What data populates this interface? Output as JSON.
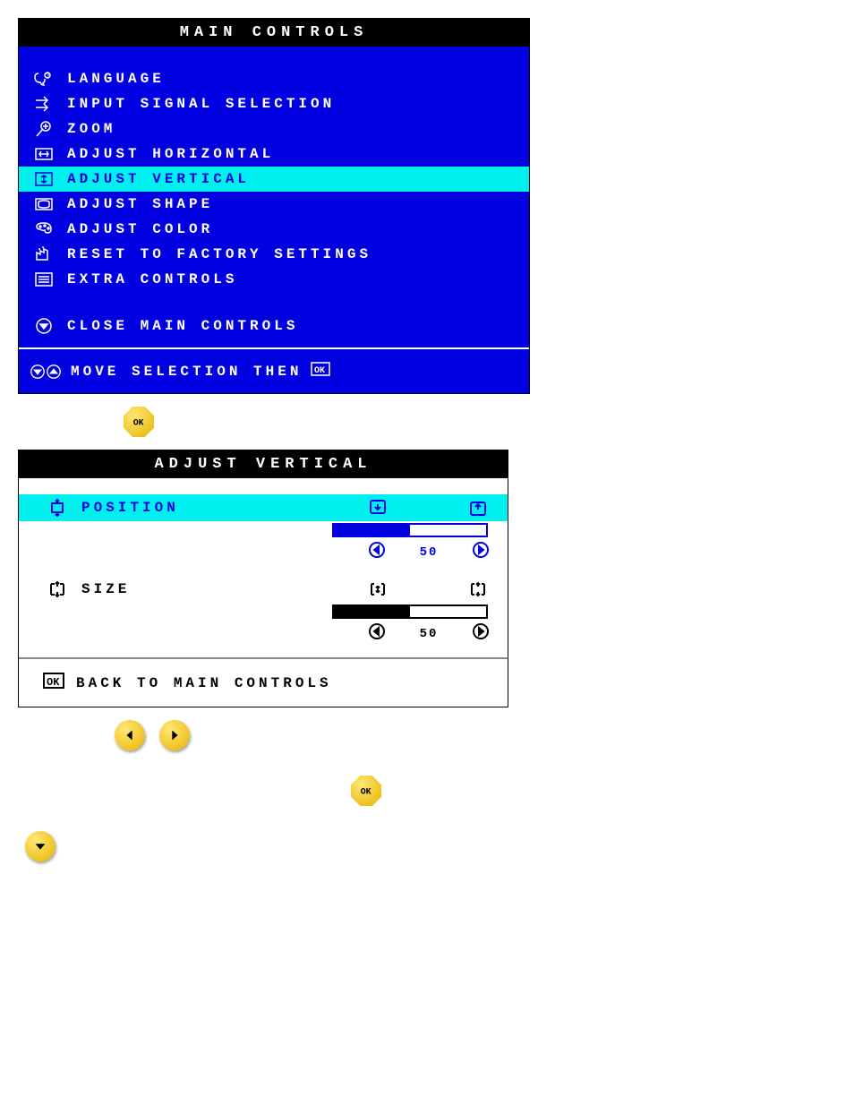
{
  "main": {
    "title": "MAIN CONTROLS",
    "items": [
      {
        "label": "LANGUAGE"
      },
      {
        "label": "INPUT SIGNAL SELECTION"
      },
      {
        "label": "ZOOM"
      },
      {
        "label": "ADJUST HORIZONTAL"
      },
      {
        "label": "ADJUST VERTICAL"
      },
      {
        "label": "ADJUST SHAPE"
      },
      {
        "label": "ADJUST COLOR"
      },
      {
        "label": "RESET TO FACTORY SETTINGS"
      },
      {
        "label": "EXTRA CONTROLS"
      }
    ],
    "close": "CLOSE MAIN CONTROLS",
    "footer": "MOVE SELECTION THEN"
  },
  "adjust": {
    "title": "ADJUST VERTICAL",
    "position": {
      "label": "POSITION",
      "value": "50",
      "pct": 50
    },
    "size": {
      "label": "SIZE",
      "value": "50",
      "pct": 50
    },
    "back": "BACK TO MAIN CONTROLS"
  }
}
